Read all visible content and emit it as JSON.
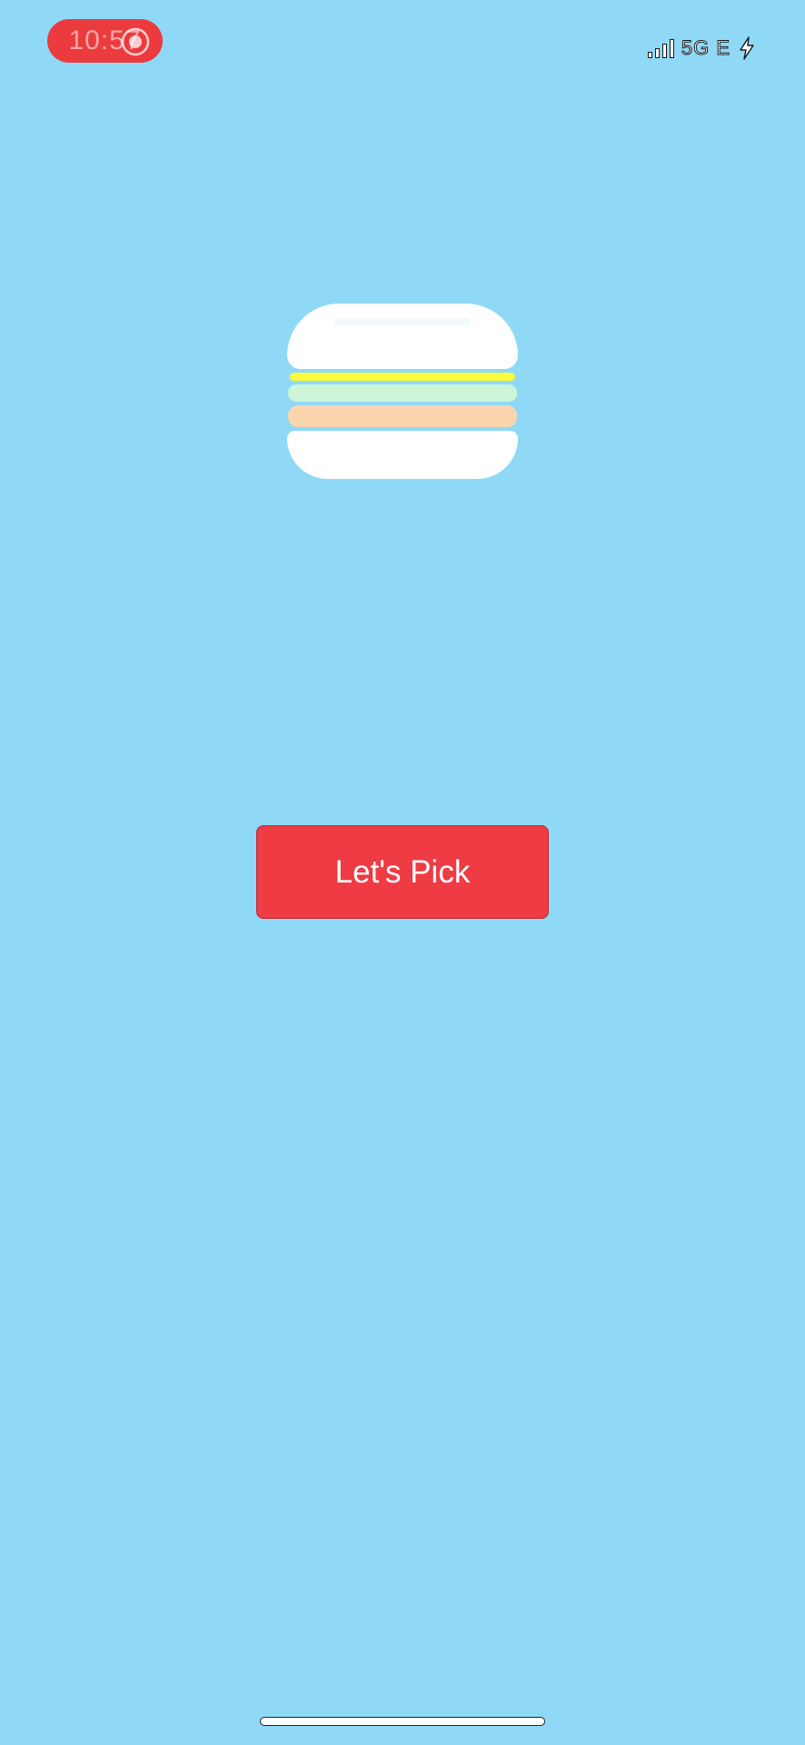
{
  "status_bar": {
    "time": "10:57",
    "network": "5G E",
    "icons": [
      "record-icon",
      "signal-icon",
      "battery-charging-icon"
    ]
  },
  "logo": {
    "icon": "burger-icon",
    "colors": {
      "bun": "#ffffff",
      "cheese": "#fbfc3e",
      "lettuce": "#ccf5d7",
      "patty": "#fbd5ae"
    }
  },
  "main": {
    "pick_button_label": "Let's Pick"
  },
  "theme": {
    "background": "#8fd9f7",
    "accent": "#ef3b44"
  }
}
